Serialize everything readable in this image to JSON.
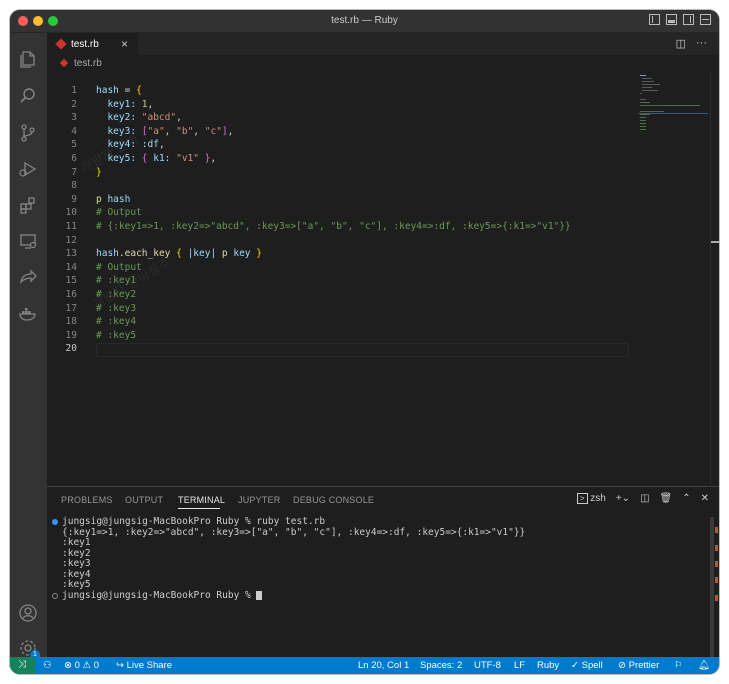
{
  "window": {
    "title": "test.rb — Ruby"
  },
  "tab": {
    "label": "test.rb",
    "close": "×"
  },
  "breadcrumb": {
    "file": "test.rb"
  },
  "code": {
    "line_numbers": [
      "1",
      "2",
      "3",
      "4",
      "5",
      "6",
      "7",
      "8",
      "9",
      "10",
      "11",
      "12",
      "13",
      "14",
      "15",
      "16",
      "17",
      "18",
      "19",
      "20"
    ],
    "lines": {
      "l1a": "hash",
      "l1b": " = ",
      "l1c": "{",
      "l2a": "  key1: ",
      "l2b": "1",
      "l2c": ",",
      "l3a": "  key2: ",
      "l3b": "\"abcd\"",
      "l3c": ",",
      "l4a": "  key3: ",
      "l4b": "[",
      "l4c": "\"a\"",
      "l4d": ", ",
      "l4e": "\"b\"",
      "l4f": ", ",
      "l4g": "\"c\"",
      "l4h": "]",
      "l4i": ",",
      "l5a": "  key4: ",
      "l5b": ":df",
      "l5c": ",",
      "l6a": "  key5: ",
      "l6b": "{ ",
      "l6c": "k1: ",
      "l6d": "\"v1\"",
      "l6e": " }",
      "l6f": ",",
      "l7a": "}",
      "l9a": "p",
      "l9b": " hash",
      "l10": "# Output",
      "l11": "# {:key1=>1, :key2=>\"abcd\", :key3=>[\"a\", \"b\", \"c\"], :key4=>:df, :key5=>{:k1=>\"v1\"}}",
      "l13a": "hash",
      "l13b": ".",
      "l13c": "each_key",
      "l13d": " { ",
      "l13e": "|key|",
      "l13f": " p ",
      "l13g": "key",
      "l13h": " }",
      "l14": "# Output",
      "l15": "# :key1",
      "l16": "# :key2",
      "l17": "# :key3",
      "l18": "# :key4",
      "l19": "# :key5"
    }
  },
  "panel": {
    "tabs": [
      "PROBLEMS",
      "OUTPUT",
      "TERMINAL",
      "JUPYTER",
      "DEBUG CONSOLE"
    ],
    "shell": "zsh"
  },
  "terminal": {
    "lines": [
      "jungsig@jungsig-MacBookPro Ruby % ruby test.rb",
      "{:key1=>1, :key2=>\"abcd\", :key3=>[\"a\", \"b\", \"c\"], :key4=>:df, :key5=>{:k1=>\"v1\"}}",
      ":key1",
      ":key2",
      ":key3",
      ":key4",
      ":key5",
      "jungsig@jungsig-MacBookPro Ruby % "
    ]
  },
  "statusbar": {
    "errors": "0",
    "warnings": "0",
    "live_share": "Live Share",
    "position": "Ln 20, Col 1",
    "spaces": "Spaces: 2",
    "encoding": "UTF-8",
    "eol": "LF",
    "language": "Ruby",
    "spell": "Spell",
    "prettier": "Prettier"
  },
  "badges": {
    "settings": "1"
  },
  "colors": {
    "accent": "#007acc",
    "remote": "#16825d",
    "ruby": "#cc342d"
  }
}
